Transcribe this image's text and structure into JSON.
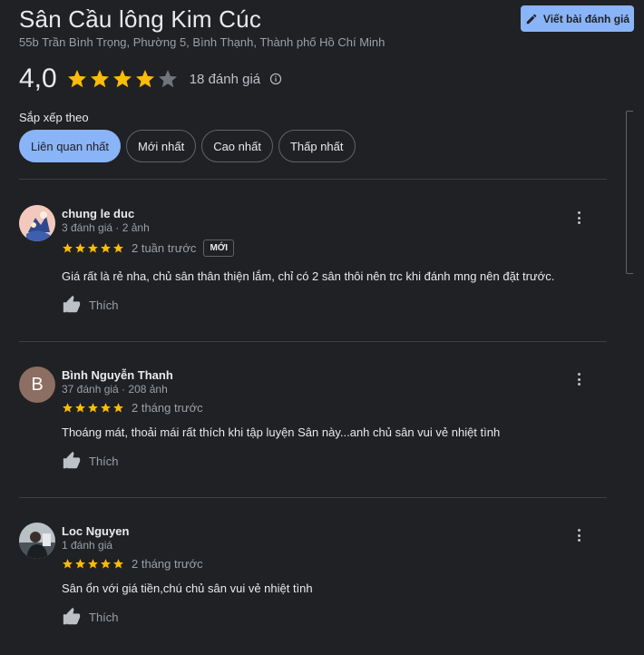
{
  "place": {
    "title": "Sân Cầu lông Kim Cúc",
    "address": "55b Trần Bình Trọng, Phường 5, Bình Thạnh, Thành phố Hồ Chí Minh"
  },
  "write_review_label": "Viết bài đánh giá",
  "summary": {
    "rating": "4,0",
    "stars": 4,
    "review_count": "18 đánh giá"
  },
  "sort": {
    "label": "Sắp xếp theo",
    "options": [
      "Liên quan nhất",
      "Mới nhất",
      "Cao nhất",
      "Thấp nhất"
    ],
    "selected": "Liên quan nhất"
  },
  "colors": {
    "accent": "#8ab4f8",
    "star": "#fbbc04",
    "background": "#202124"
  },
  "reviews": [
    {
      "name": "chung le duc",
      "meta": "3 đánh giá · 2 ảnh",
      "stars": 5,
      "date": "2 tuần trước",
      "badge": "MỚI",
      "text": "Giá rất là rẻ nha, chủ sân thân thiện lắm, chỉ có 2 sân thôi nên trc khi đánh mng nên đặt trước.",
      "like_label": "Thích",
      "avatar": "illustration-avatar"
    },
    {
      "name": "Bình Nguyễn Thanh",
      "meta": "37 đánh giá · 208 ảnh",
      "stars": 5,
      "date": "2 tháng trước",
      "text": "Thoáng mát, thoải mái rất thích khi tập luyện Sân này...anh chủ sân vui vẻ nhiệt tình",
      "like_label": "Thích",
      "avatar_letter": "B"
    },
    {
      "name": "Loc Nguyen",
      "meta": "1 đánh giá",
      "stars": 5,
      "date": "2 tháng trước",
      "text": "Sân ổn với giá tiền,chú chủ sân vui vẻ nhiệt tình",
      "like_label": "Thích",
      "avatar": "photo-avatar"
    }
  ]
}
